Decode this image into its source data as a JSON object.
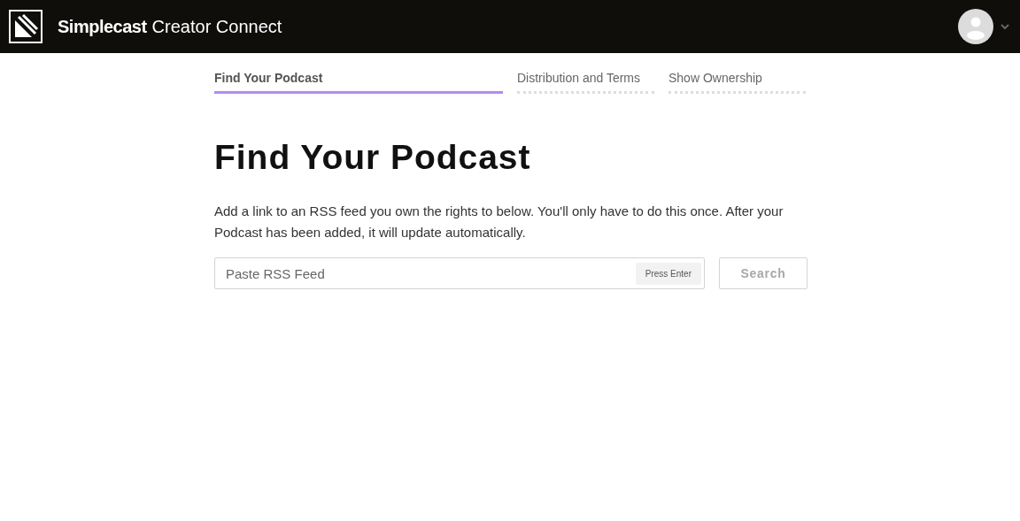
{
  "header": {
    "brand_bold": "Simplecast",
    "brand_rest": "Creator Connect"
  },
  "steps": [
    {
      "label": "Find Your Podcast",
      "selected": true
    },
    {
      "label": "Distribution and Terms",
      "selected": false
    },
    {
      "label": "Show Ownership",
      "selected": false
    }
  ],
  "heading": "Find Your Podcast",
  "description": "Add a link to an RSS feed you own the rights to below. You'll only have to do this once. After your Podcast has been added, it will update automatically.",
  "feed_field": {
    "placeholder": "Paste RSS Feed",
    "hint": "Press Enter"
  },
  "search_button": {
    "label": "Search",
    "disabled": true
  }
}
